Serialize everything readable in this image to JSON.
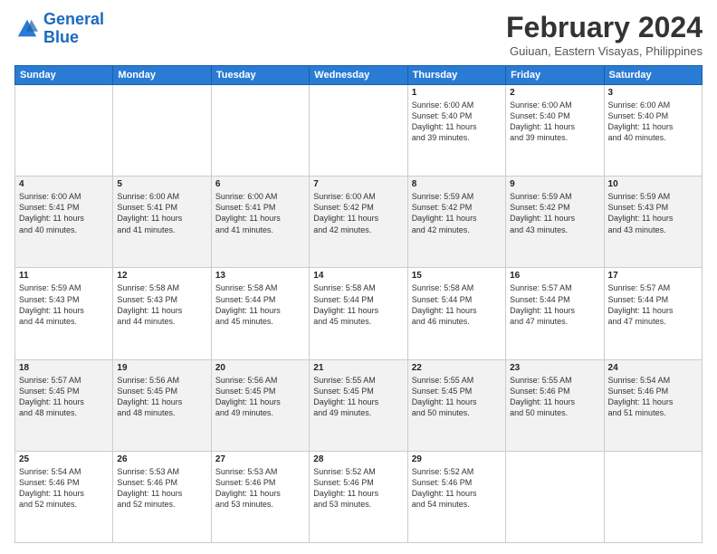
{
  "logo": {
    "line1": "General",
    "line2": "Blue"
  },
  "title": "February 2024",
  "subtitle": "Guiuan, Eastern Visayas, Philippines",
  "header_days": [
    "Sunday",
    "Monday",
    "Tuesday",
    "Wednesday",
    "Thursday",
    "Friday",
    "Saturday"
  ],
  "weeks": [
    [
      {
        "day": "",
        "info": ""
      },
      {
        "day": "",
        "info": ""
      },
      {
        "day": "",
        "info": ""
      },
      {
        "day": "",
        "info": ""
      },
      {
        "day": "1",
        "info": "Sunrise: 6:00 AM\nSunset: 5:40 PM\nDaylight: 11 hours\nand 39 minutes."
      },
      {
        "day": "2",
        "info": "Sunrise: 6:00 AM\nSunset: 5:40 PM\nDaylight: 11 hours\nand 39 minutes."
      },
      {
        "day": "3",
        "info": "Sunrise: 6:00 AM\nSunset: 5:40 PM\nDaylight: 11 hours\nand 40 minutes."
      }
    ],
    [
      {
        "day": "4",
        "info": "Sunrise: 6:00 AM\nSunset: 5:41 PM\nDaylight: 11 hours\nand 40 minutes."
      },
      {
        "day": "5",
        "info": "Sunrise: 6:00 AM\nSunset: 5:41 PM\nDaylight: 11 hours\nand 41 minutes."
      },
      {
        "day": "6",
        "info": "Sunrise: 6:00 AM\nSunset: 5:41 PM\nDaylight: 11 hours\nand 41 minutes."
      },
      {
        "day": "7",
        "info": "Sunrise: 6:00 AM\nSunset: 5:42 PM\nDaylight: 11 hours\nand 42 minutes."
      },
      {
        "day": "8",
        "info": "Sunrise: 5:59 AM\nSunset: 5:42 PM\nDaylight: 11 hours\nand 42 minutes."
      },
      {
        "day": "9",
        "info": "Sunrise: 5:59 AM\nSunset: 5:42 PM\nDaylight: 11 hours\nand 43 minutes."
      },
      {
        "day": "10",
        "info": "Sunrise: 5:59 AM\nSunset: 5:43 PM\nDaylight: 11 hours\nand 43 minutes."
      }
    ],
    [
      {
        "day": "11",
        "info": "Sunrise: 5:59 AM\nSunset: 5:43 PM\nDaylight: 11 hours\nand 44 minutes."
      },
      {
        "day": "12",
        "info": "Sunrise: 5:58 AM\nSunset: 5:43 PM\nDaylight: 11 hours\nand 44 minutes."
      },
      {
        "day": "13",
        "info": "Sunrise: 5:58 AM\nSunset: 5:44 PM\nDaylight: 11 hours\nand 45 minutes."
      },
      {
        "day": "14",
        "info": "Sunrise: 5:58 AM\nSunset: 5:44 PM\nDaylight: 11 hours\nand 45 minutes."
      },
      {
        "day": "15",
        "info": "Sunrise: 5:58 AM\nSunset: 5:44 PM\nDaylight: 11 hours\nand 46 minutes."
      },
      {
        "day": "16",
        "info": "Sunrise: 5:57 AM\nSunset: 5:44 PM\nDaylight: 11 hours\nand 47 minutes."
      },
      {
        "day": "17",
        "info": "Sunrise: 5:57 AM\nSunset: 5:44 PM\nDaylight: 11 hours\nand 47 minutes."
      }
    ],
    [
      {
        "day": "18",
        "info": "Sunrise: 5:57 AM\nSunset: 5:45 PM\nDaylight: 11 hours\nand 48 minutes."
      },
      {
        "day": "19",
        "info": "Sunrise: 5:56 AM\nSunset: 5:45 PM\nDaylight: 11 hours\nand 48 minutes."
      },
      {
        "day": "20",
        "info": "Sunrise: 5:56 AM\nSunset: 5:45 PM\nDaylight: 11 hours\nand 49 minutes."
      },
      {
        "day": "21",
        "info": "Sunrise: 5:55 AM\nSunset: 5:45 PM\nDaylight: 11 hours\nand 49 minutes."
      },
      {
        "day": "22",
        "info": "Sunrise: 5:55 AM\nSunset: 5:45 PM\nDaylight: 11 hours\nand 50 minutes."
      },
      {
        "day": "23",
        "info": "Sunrise: 5:55 AM\nSunset: 5:46 PM\nDaylight: 11 hours\nand 50 minutes."
      },
      {
        "day": "24",
        "info": "Sunrise: 5:54 AM\nSunset: 5:46 PM\nDaylight: 11 hours\nand 51 minutes."
      }
    ],
    [
      {
        "day": "25",
        "info": "Sunrise: 5:54 AM\nSunset: 5:46 PM\nDaylight: 11 hours\nand 52 minutes."
      },
      {
        "day": "26",
        "info": "Sunrise: 5:53 AM\nSunset: 5:46 PM\nDaylight: 11 hours\nand 52 minutes."
      },
      {
        "day": "27",
        "info": "Sunrise: 5:53 AM\nSunset: 5:46 PM\nDaylight: 11 hours\nand 53 minutes."
      },
      {
        "day": "28",
        "info": "Sunrise: 5:52 AM\nSunset: 5:46 PM\nDaylight: 11 hours\nand 53 minutes."
      },
      {
        "day": "29",
        "info": "Sunrise: 5:52 AM\nSunset: 5:46 PM\nDaylight: 11 hours\nand 54 minutes."
      },
      {
        "day": "",
        "info": ""
      },
      {
        "day": "",
        "info": ""
      }
    ]
  ]
}
